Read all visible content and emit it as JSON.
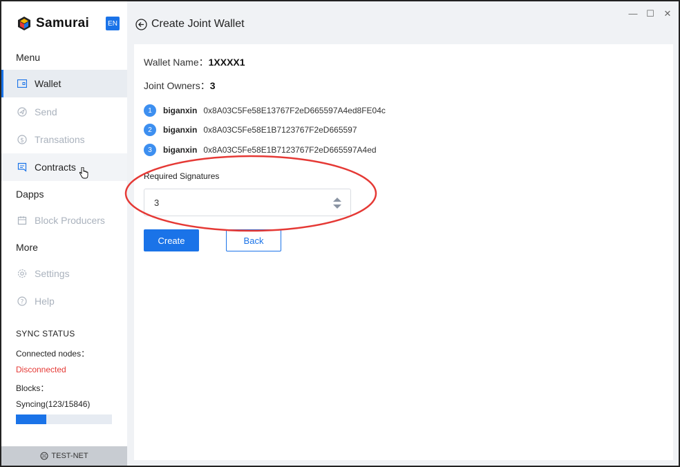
{
  "app": {
    "brand": "Samurai",
    "lang": "EN"
  },
  "sidebar": {
    "menu_label": "Menu",
    "items": [
      {
        "label": "Wallet",
        "icon": "wallet-icon"
      },
      {
        "label": "Send",
        "icon": "send-icon"
      },
      {
        "label": "Transations",
        "icon": "transactions-icon"
      },
      {
        "label": "Contracts",
        "icon": "contracts-icon"
      }
    ],
    "dapps_label": "Dapps",
    "dapps_items": [
      {
        "label": "Block Producers",
        "icon": "block-producers-icon"
      }
    ],
    "more_label": "More",
    "more_items": [
      {
        "label": "Settings",
        "icon": "gear-icon"
      },
      {
        "label": "Help",
        "icon": "help-icon"
      }
    ]
  },
  "sync": {
    "title": "SYNC STATUS",
    "nodes_label": "Connected nodes：",
    "nodes_value": "Disconnected",
    "blocks_label": "Blocks：",
    "blocks_value": "Syncing(123/15846)",
    "progress": 0.32
  },
  "network": "TEST-NET",
  "page": {
    "title": "Create Joint Wallet"
  },
  "form": {
    "wallet_name_label": "Wallet Name：",
    "wallet_name_value": "1XXXX1",
    "owners_label": "Joint Owners：",
    "owners_value": "3",
    "owners": [
      {
        "num": "1",
        "name": "biganxin",
        "address": "0x8A03C5Fe58E13767F2eD665597A4ed8FE04c"
      },
      {
        "num": "2",
        "name": "biganxin",
        "address": "0x8A03C5Fe58E1B7123767F2eD665597"
      },
      {
        "num": "3",
        "name": "biganxin",
        "address": "0x8A03C5Fe58E1B7123767F2eD665597A4ed"
      }
    ],
    "required_label": "Required Signatures",
    "required_value": "3",
    "create_label": "Create",
    "back_label": "Back"
  },
  "colors": {
    "accent": "#1a73e8",
    "danger": "#e53935",
    "annotation": "#e53935"
  }
}
